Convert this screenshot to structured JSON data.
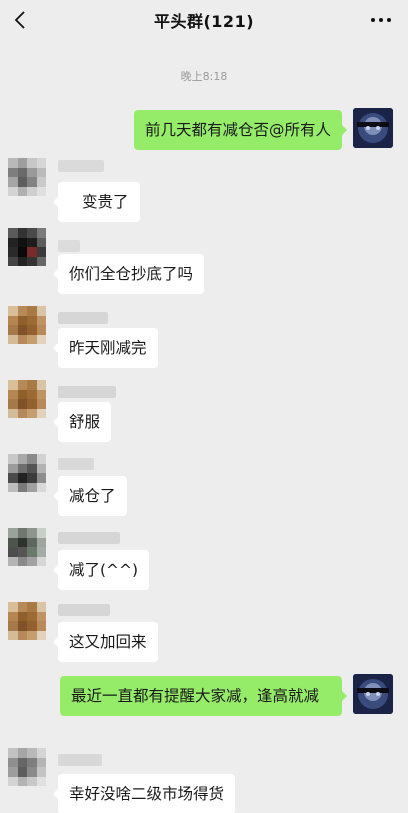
{
  "header": {
    "title": "平头群(121)",
    "back_icon": "chevron-left-icon",
    "more_icon": "more-dots-icon"
  },
  "timestamp": "晚上8:18",
  "messages": [
    {
      "sender": "self",
      "text": "前几天都有减仓否@所有人"
    },
    {
      "sender": "other",
      "text": "变贵了"
    },
    {
      "sender": "other",
      "text": "你们全仓抄底了吗"
    },
    {
      "sender": "other",
      "text": "昨天刚减完"
    },
    {
      "sender": "other",
      "text": "舒服"
    },
    {
      "sender": "other",
      "text": "减仓了"
    },
    {
      "sender": "other",
      "text": "减了(^^)"
    },
    {
      "sender": "other",
      "text": "这又加回来"
    },
    {
      "sender": "self",
      "text": "最近一直都有提醒大家减，逢高就减"
    },
    {
      "sender": "other",
      "text": "幸好没啥二级市场得货"
    }
  ],
  "colors": {
    "background": "#ededed",
    "self_bubble": "#95ec69",
    "other_bubble": "#ffffff"
  }
}
